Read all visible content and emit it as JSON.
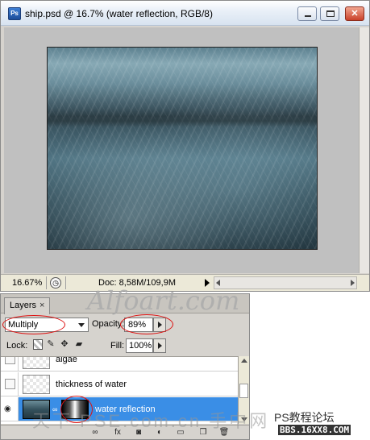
{
  "document_window": {
    "title": "ship.psd @ 16.7% (water reflection, RGB/8)",
    "app_icon_text": "Ps",
    "buttons": {
      "minimize": "minimize",
      "maximize": "maximize",
      "close": "✕"
    },
    "status": {
      "zoom": "16.67%",
      "doc_info": "Doc: 8,58M/109,9M"
    }
  },
  "layers_panel": {
    "tab_label": "Layers",
    "tab_close": "×",
    "blend_mode": "Multiply",
    "opacity_label": "Opacity:",
    "opacity_value": "89%",
    "lock_label": "Lock:",
    "fill_label": "Fill:",
    "fill_value": "100%",
    "layers": [
      {
        "name": "algae",
        "visible": false,
        "selected": false
      },
      {
        "name": "thickness of water",
        "visible": false,
        "selected": false
      },
      {
        "name": "water reflection",
        "visible": true,
        "selected": true
      }
    ]
  },
  "watermarks": {
    "alfoart": "Alfoart.com",
    "cn_overlay": "天下 PSE.com.cn 手中网",
    "ps_forum": "PS教程论坛",
    "bbs_url": "BBS.16XX8.COM"
  },
  "colors": {
    "selection_blue": "#3a8ee6",
    "annotation_red": "#d11111",
    "panel_gray": "#d6d3ce"
  }
}
